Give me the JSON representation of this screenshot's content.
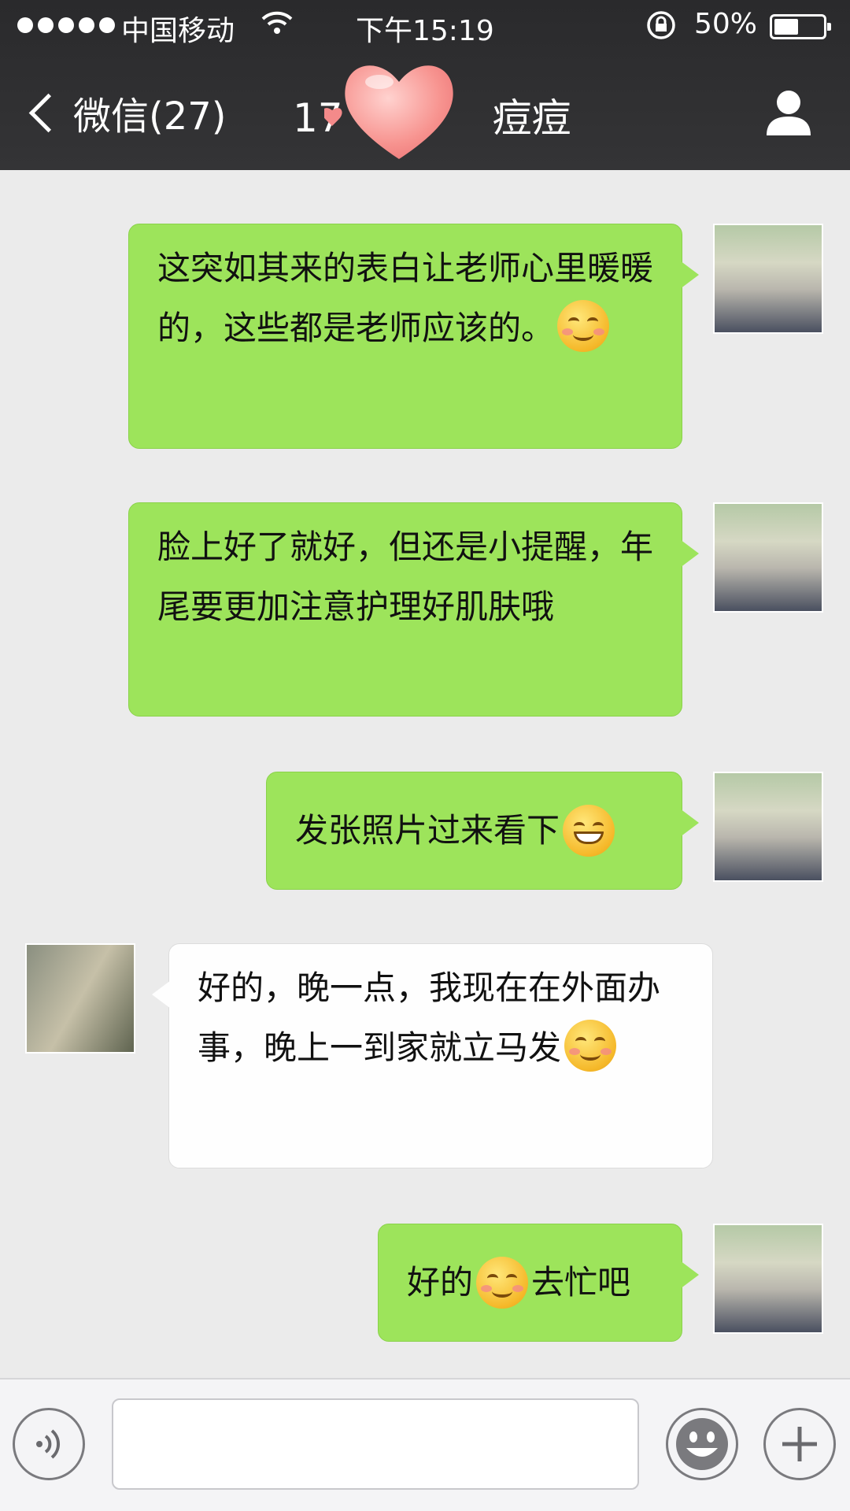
{
  "status_bar": {
    "carrier": "中国移动",
    "time": "下午15:19",
    "battery_percent": "50%",
    "battery_level": 0.5
  },
  "nav": {
    "back_label": "微信(27)",
    "title_prefix": "17",
    "title_suffix": "痘痘"
  },
  "messages": [
    {
      "direction": "out",
      "text": "这突如其来的表白让老师心里暖暖的，这些都是老师应该的。",
      "emoji": "smile-emoji"
    },
    {
      "direction": "out",
      "text": "脸上好了就好，但还是小提醒，年尾要更加注意护理好肌肤哦"
    },
    {
      "direction": "out",
      "text": "发张照片过来看下",
      "emoji": "grin-emoji"
    },
    {
      "direction": "in",
      "text": "好的，晚一点，我现在在外面办事，晚上一到家就立马发",
      "emoji": "smile-emoji"
    },
    {
      "direction": "out",
      "text_before": "好的",
      "emoji": "smile-emoji",
      "text_after": "去忙吧"
    }
  ],
  "input_bar": {
    "voice_icon": "voice-icon",
    "emoji_icon": "emoji-face-icon",
    "plus_icon": "plus-icon",
    "value": ""
  },
  "colors": {
    "header_bg": "#2f2f31",
    "chat_bg": "#ebebeb",
    "outgoing_bubble": "#9de45b",
    "incoming_bubble": "#fefefe"
  }
}
